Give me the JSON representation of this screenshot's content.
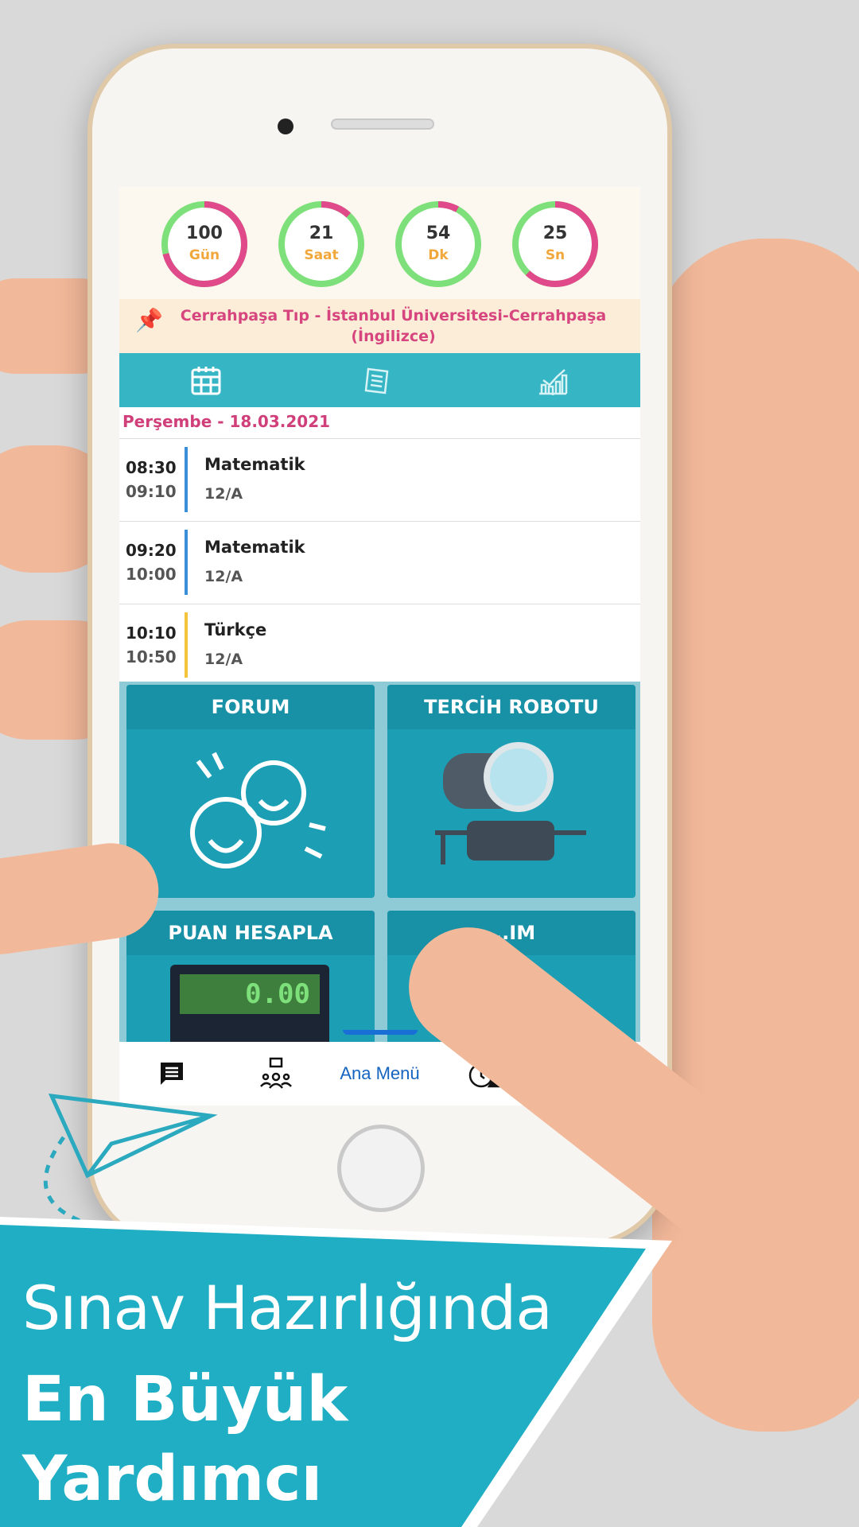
{
  "countdown": [
    {
      "value": "100",
      "unit": "Gün",
      "remaining_fraction": 0.71
    },
    {
      "value": "21",
      "unit": "Saat",
      "remaining_fraction": 0.12
    },
    {
      "value": "54",
      "unit": "Dk",
      "remaining_fraction": 0.08
    },
    {
      "value": "25",
      "unit": "Sn",
      "remaining_fraction": 0.62
    }
  ],
  "colors": {
    "ring_green": "#7ee07a",
    "ring_pink": "#e0498a",
    "teal": "#36b5c4",
    "accent_pink": "#d7457f",
    "nav_active": "#1565c0"
  },
  "target": {
    "icon": "pushpin-icon",
    "line1": "Cerrahpaşa Tıp - İstanbul Üniversitesi-Cerrahpaşa",
    "line2": "(İngilizce)"
  },
  "tabs": [
    {
      "icon": "calendar-icon",
      "active": true
    },
    {
      "icon": "notes-icon"
    },
    {
      "icon": "chart-icon"
    }
  ],
  "schedule": {
    "date": "Perşembe - 18.03.2021",
    "lessons": [
      {
        "start": "08:30",
        "end": "09:10",
        "subject": "Matematik",
        "class": "12/A",
        "color": "#3b8fd9"
      },
      {
        "start": "09:20",
        "end": "10:00",
        "subject": "Matematik",
        "class": "12/A",
        "color": "#3b8fd9"
      },
      {
        "start": "10:10",
        "end": "10:50",
        "subject": "Türkçe",
        "class": "12/A",
        "color": "#f2c33b"
      }
    ]
  },
  "tiles": [
    {
      "label": "FORUM"
    },
    {
      "label": "TERCİH ROBOTU"
    },
    {
      "label": "PUAN HESAPLA",
      "display": "0.00"
    },
    {
      "label": "...IM"
    }
  ],
  "bottom_nav": {
    "items": [
      {
        "icon": "message-icon"
      },
      {
        "icon": "group-chat-icon"
      },
      {
        "label": "Ana Menü"
      },
      {
        "icon": "timer-bell-icon"
      }
    ]
  },
  "promo": {
    "line1": "Sınav Hazırlığında",
    "line2": "En Büyük",
    "line3": "Yardımcı"
  }
}
